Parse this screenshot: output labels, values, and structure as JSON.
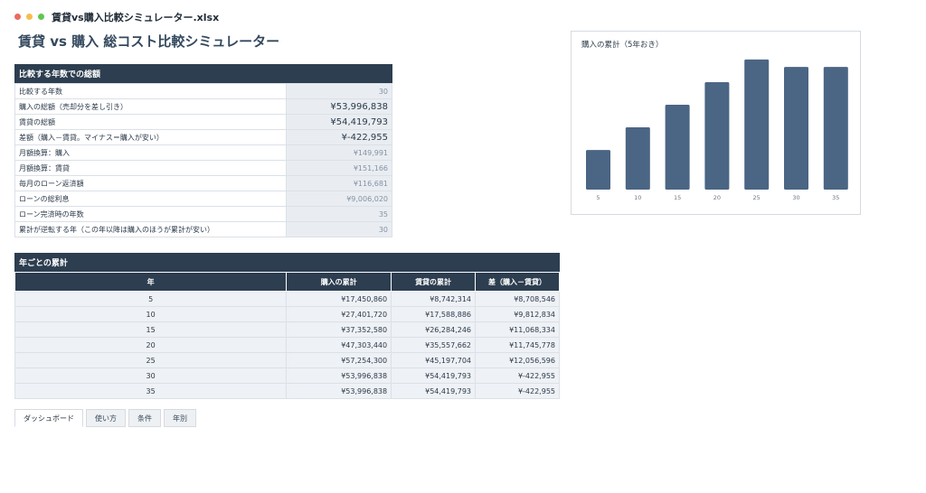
{
  "window": {
    "file_name": "賃貸vs購入比較シミュレーター.xlsx"
  },
  "page": {
    "title": "賃貸 vs 購入 総コスト比較シミュレーター"
  },
  "summary": {
    "title": "比較する年数での総額",
    "rows": [
      {
        "label": "比較する年数",
        "value": "30"
      },
      {
        "label": "購入の総額（売却分を差し引き）",
        "value": "¥53,996,838"
      },
      {
        "label": "賃貸の総額",
        "value": "¥54,419,793"
      },
      {
        "label": "差額（購入－賃貸。マイナス＝購入が安い）",
        "value": "¥-422,955"
      },
      {
        "label": "月額換算：購入",
        "value": "¥149,991"
      },
      {
        "label": "月額換算：賃貸",
        "value": "¥151,166"
      },
      {
        "label": "毎月のローン返済額",
        "value": "¥116,681"
      },
      {
        "label": "ローンの総利息",
        "value": "¥9,006,020"
      },
      {
        "label": "ローン完済時の年数",
        "value": "35"
      },
      {
        "label": "累計が逆転する年（この年以降は購入のほうが累計が安い）",
        "value": "30"
      }
    ]
  },
  "yearly": {
    "title": "年ごとの累計",
    "headers": [
      "年",
      "購入の累計",
      "賃貸の累計",
      "差（購入－賃貸）"
    ],
    "rows": [
      [
        "5",
        "¥17,450,860",
        "¥8,742,314",
        "¥8,708,546"
      ],
      [
        "10",
        "¥27,401,720",
        "¥17,588,886",
        "¥9,812,834"
      ],
      [
        "15",
        "¥37,352,580",
        "¥26,284,246",
        "¥11,068,334"
      ],
      [
        "20",
        "¥47,303,440",
        "¥35,557,662",
        "¥11,745,778"
      ],
      [
        "25",
        "¥57,254,300",
        "¥45,197,704",
        "¥12,056,596"
      ],
      [
        "30",
        "¥53,996,838",
        "¥54,419,793",
        "¥-422,955"
      ],
      [
        "35",
        "¥53,996,838",
        "¥54,419,793",
        "¥-422,955"
      ]
    ]
  },
  "chart_data": {
    "type": "bar",
    "title": "購入の累計（5年おき）",
    "categories": [
      "5",
      "10",
      "15",
      "20",
      "25",
      "30",
      "35"
    ],
    "values": [
      17450860,
      27401720,
      37352580,
      47303440,
      57254300,
      53996838,
      53996838
    ],
    "ylim": [
      0,
      60000000
    ],
    "grid": false,
    "legend": "none",
    "bar_color": "#4b6584"
  },
  "tabs": [
    "ダッシュボード",
    "使い方",
    "条件",
    "年別"
  ],
  "colors": {
    "header_bg": "#2d3e50",
    "value_bg": "#e9edf2",
    "bar": "#4b6584"
  }
}
